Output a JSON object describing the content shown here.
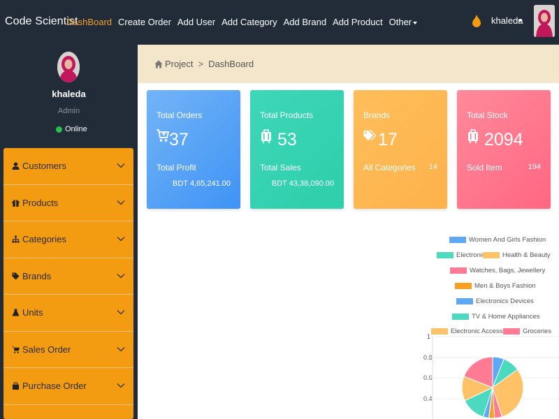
{
  "navbar": {
    "brand": "Code Scientist",
    "items": [
      {
        "label": "DashBoard",
        "active": true
      },
      {
        "label": "Create Order"
      },
      {
        "label": "Add User"
      },
      {
        "label": "Add Category"
      },
      {
        "label": "Add Brand"
      },
      {
        "label": "Add Product"
      },
      {
        "label": "Other"
      }
    ],
    "user": "khaleda"
  },
  "sidebar": {
    "name": "khaleda",
    "role": "Admin",
    "status": "Online",
    "items": [
      {
        "label": "Customers",
        "icon": "user-icon"
      },
      {
        "label": "Products",
        "icon": "gift-icon"
      },
      {
        "label": "Categories",
        "icon": "sitemap-icon"
      },
      {
        "label": "Brands",
        "icon": "tag-icon"
      },
      {
        "label": "Units",
        "icon": "flask-icon"
      },
      {
        "label": "Sales Order",
        "icon": "cart-icon"
      },
      {
        "label": "Purchase Order",
        "icon": "bag-icon"
      }
    ]
  },
  "breadcrumb": {
    "root": "Project",
    "sep": ">",
    "current": "DashBoard"
  },
  "cards": [
    {
      "title": "Total Orders",
      "value": "37",
      "sub_label": "Total Profit",
      "amount": "BDT 4,65,241.00",
      "color": "#4a9cf6"
    },
    {
      "title": "Total Products",
      "value": "53",
      "sub_label": "Total Sales",
      "amount": "BDT 43,38,090.00",
      "color": "#34d3b2"
    },
    {
      "title": "Brands",
      "value": "17",
      "sub_label": "All Categories",
      "sub_value": "14",
      "color": "#fdb850"
    },
    {
      "title": "Total Stock",
      "value": "2094",
      "sub_label": "Sold Item",
      "sub_value": "194",
      "color": "#ff7890"
    }
  ],
  "chart_data": {
    "type": "pie",
    "legend": [
      {
        "label": "Women And Girls Fashion",
        "color": "#5fa8f5"
      },
      {
        "label": "Electronics",
        "color": "#4bd9c0"
      },
      {
        "label": "Health & Beauty",
        "color": "#ffc266"
      },
      {
        "label": "Watches, Bags, Jewellery",
        "color": "#ff7a92"
      },
      {
        "label": "Men & Boys Fashion",
        "color": "#f7a022"
      },
      {
        "label": "Electronics Devices",
        "color": "#5fa8f5"
      },
      {
        "label": "TV & Home Appliances",
        "color": "#4bd9c0"
      },
      {
        "label": "Electronic Accessories",
        "color": "#ffc266"
      },
      {
        "label": "Groceries",
        "color": "#ff7a92"
      }
    ],
    "y_ticks": [
      "1",
      "0.8",
      "0.6",
      "0.4"
    ],
    "slices": [
      {
        "label": "Women And Girls Fashion",
        "value": 6,
        "color": "#5fa8f5"
      },
      {
        "label": "Electronics",
        "value": 9,
        "color": "#4bd9c0"
      },
      {
        "label": "Health & Beauty",
        "value": 30,
        "color": "#ffc266"
      },
      {
        "label": "Watches, Bags, Jewellery",
        "value": 4,
        "color": "#ff7a92"
      },
      {
        "label": "Men & Boys Fashion",
        "value": 3,
        "color": "#f7a022"
      },
      {
        "label": "Electronics Devices",
        "value": 3,
        "color": "#5fa8f5"
      },
      {
        "label": "TV & Home Appliances",
        "value": 13,
        "color": "#4bd9c0"
      },
      {
        "label": "Electronic Accessories",
        "value": 13,
        "color": "#ffc266"
      },
      {
        "label": "Groceries",
        "value": 19,
        "color": "#ff7a92"
      }
    ]
  }
}
